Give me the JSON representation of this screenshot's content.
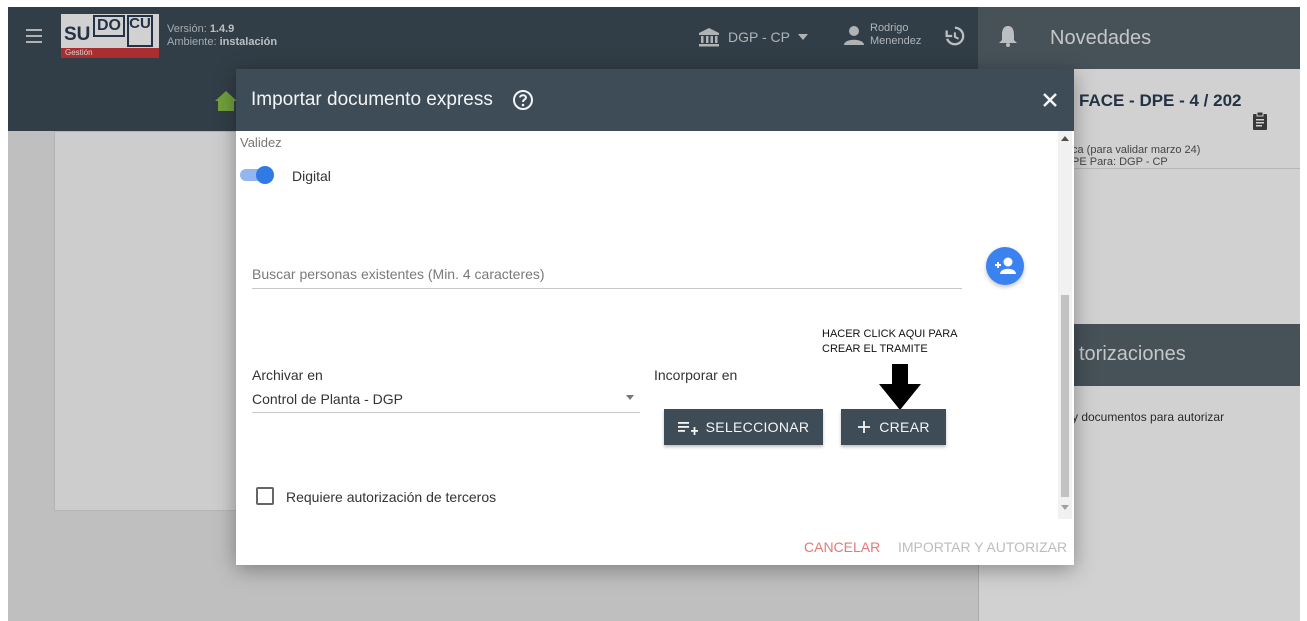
{
  "app": {
    "version_label": "Versión:",
    "version_value": "1.4.9",
    "environment_label": "Ambiente:",
    "environment_value": "instalación",
    "logo_su": "SU",
    "logo_do": "DO",
    "logo_cu": "CU",
    "logo_subtitle": "Gestión",
    "organization": "DGP - CP",
    "user_first": "Rodrigo",
    "user_last": "Menendez",
    "novedades": "Novedades"
  },
  "right_panel": {
    "doc_title": "FACE - DPE - 4 / 202",
    "doc_line1": "ca (para validar marzo 24)",
    "doc_line2": "PE Para: DGP - CP",
    "auth_title": "torizaciones",
    "auth_message": "y documentos para autorizar"
  },
  "modal": {
    "title": "Importar documento express",
    "validez_label": "Validez",
    "toggle_label": "Digital",
    "toggle_on": true,
    "search_placeholder": "Buscar personas existentes (Min. 4 caracteres)",
    "annotation_line1": "HACER CLICK AQUI PARA",
    "annotation_line2": "CREAR EL TRAMITE",
    "archivar_label": "Archivar en",
    "archivar_value": "Control de Planta - DGP",
    "incorporar_label": "Incorporar en",
    "seleccionar_label": "SELECCIONAR",
    "crear_label": "CREAR",
    "checkbox_label": "Requiere autorización de terceros",
    "checkbox_checked": false,
    "cancel_label": "CANCELAR",
    "import_label": "IMPORTAR Y AUTORIZAR"
  },
  "colors": {
    "header": "#3d4c57",
    "accent_blue": "#3b82f0",
    "cancel_red": "#e47777",
    "disabled_gray": "#bdbdbd"
  },
  "icons": [
    "menu-icon",
    "bank-icon",
    "person-icon",
    "history-icon",
    "bell-icon",
    "home-icon",
    "clipboard-icon",
    "help-icon",
    "close-icon",
    "add-person-icon",
    "playlist-add-icon",
    "plus-icon",
    "down-arrow-icon"
  ]
}
